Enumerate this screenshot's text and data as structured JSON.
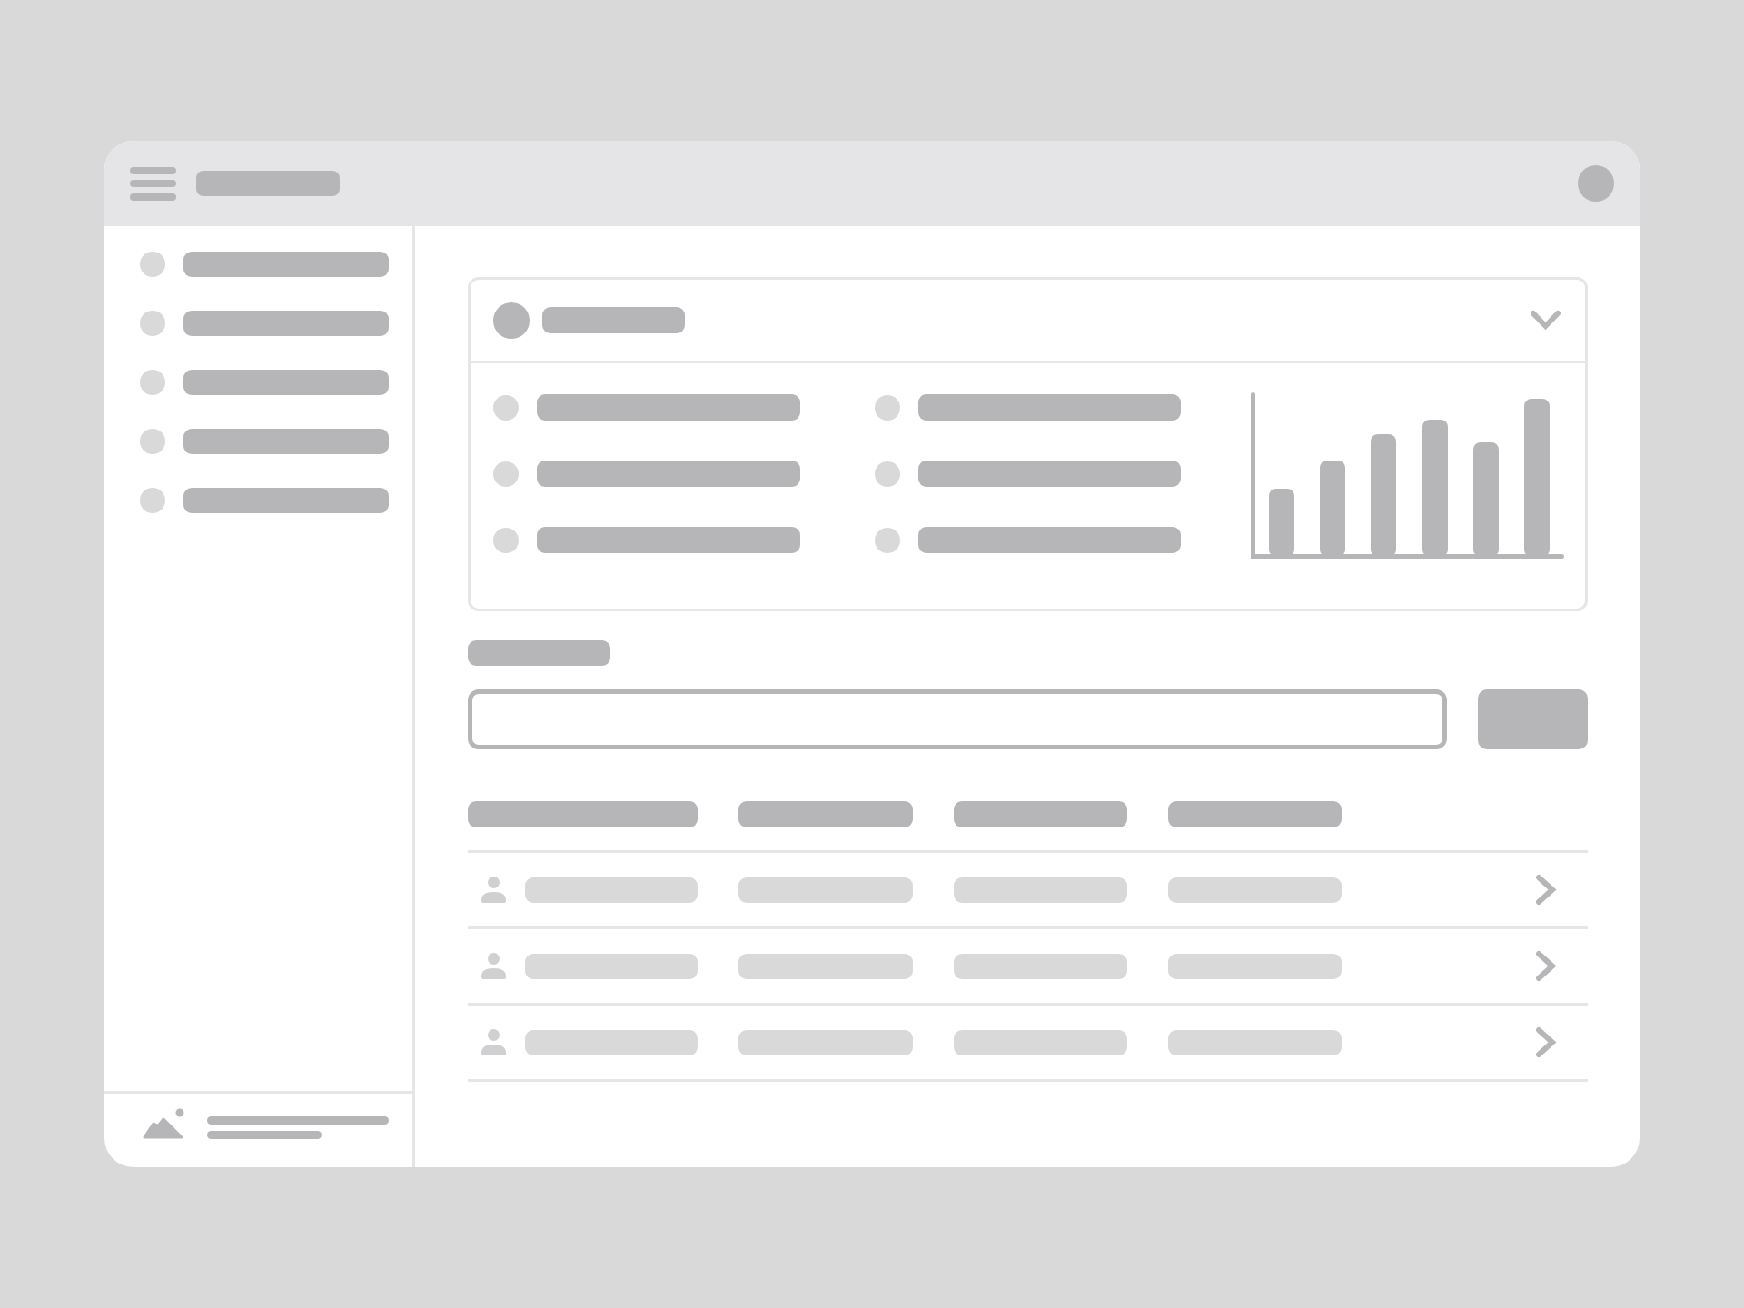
{
  "details_panel": {
    "expanded": true
  }
}
